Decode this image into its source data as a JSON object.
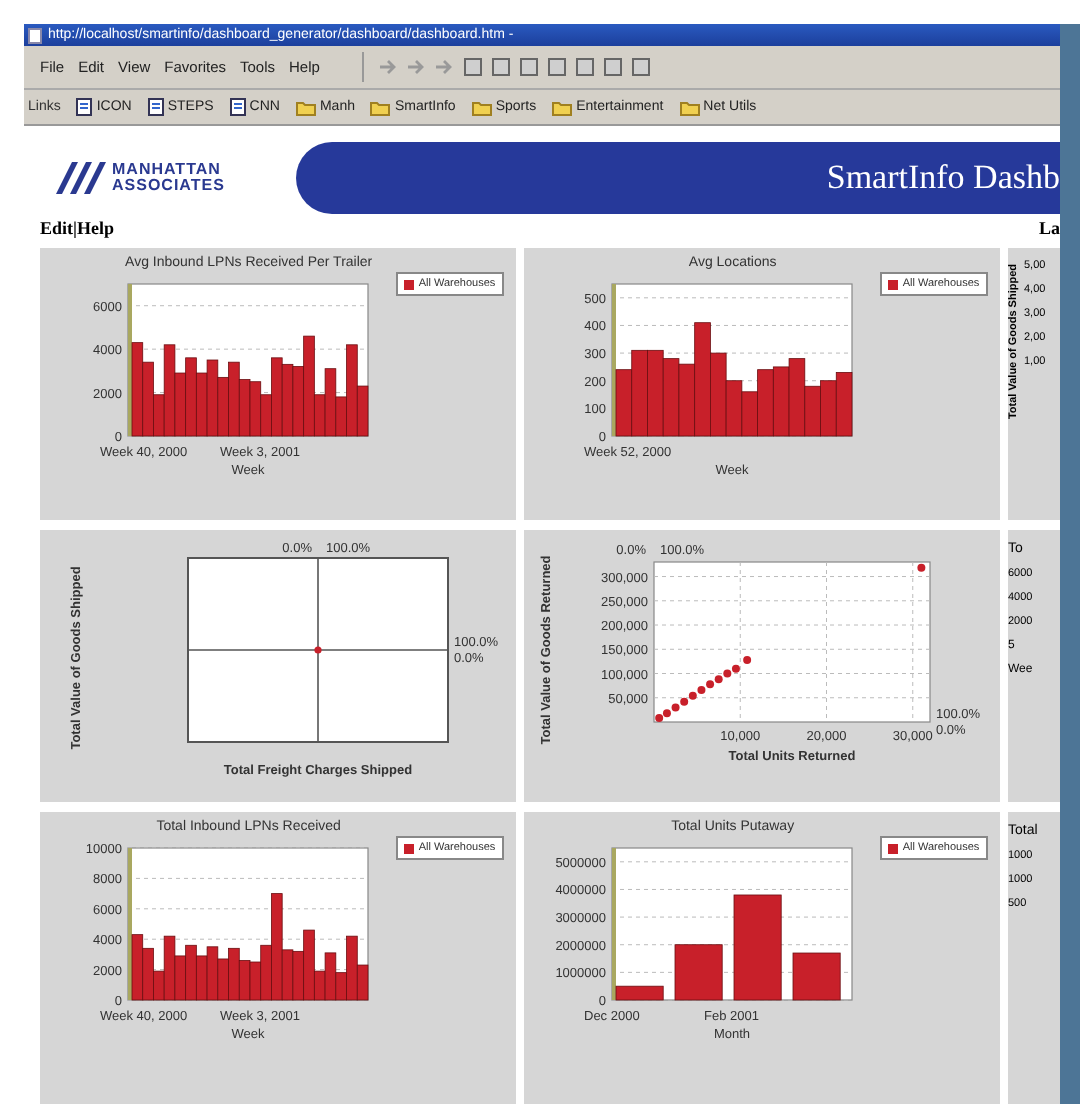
{
  "browser": {
    "title": "http://localhost/smartinfo/dashboard_generator/dashboard/dashboard.htm -",
    "menu": [
      "File",
      "Edit",
      "View",
      "Favorites",
      "Tools",
      "Help"
    ],
    "links_label": "Links",
    "links": [
      {
        "kind": "page",
        "label": "ICON"
      },
      {
        "kind": "page",
        "label": "STEPS"
      },
      {
        "kind": "page",
        "label": "CNN"
      },
      {
        "kind": "folder",
        "label": "Manh"
      },
      {
        "kind": "folder",
        "label": "SmartInfo"
      },
      {
        "kind": "folder",
        "label": "Sports"
      },
      {
        "kind": "folder",
        "label": "Entertainment"
      },
      {
        "kind": "folder",
        "label": "Net Utils"
      }
    ]
  },
  "page": {
    "logo_lines": [
      "MANHATTAN",
      "ASSOCIATES"
    ],
    "banner_title": "SmartInfo Dashb",
    "nav": "Edit|Help",
    "right_text": "La"
  },
  "rows": [
    {
      "panels": [
        {
          "kind": "chart",
          "tick_labels": [
            "Week 40, 2000",
            "Week 3, 2001"
          ],
          "chart_data": {
            "type": "bar",
            "title": "Avg Inbound LPNs Received Per Trailer",
            "xlabel": "Week",
            "ylim": [
              0,
              7000
            ],
            "yticks": [
              0,
              2000,
              4000,
              6000
            ],
            "grid": true,
            "series": [
              {
                "name": "All Warehouses",
                "color": "#c8202a",
                "values": [
                  4300,
                  3400,
                  1900,
                  4200,
                  2900,
                  3600,
                  2900,
                  3500,
                  2700,
                  3400,
                  2600,
                  2500,
                  1900,
                  3600,
                  3300,
                  3200,
                  4600,
                  1900,
                  3100,
                  1800,
                  4200,
                  2300
                ]
              }
            ]
          }
        },
        {
          "kind": "chart",
          "tick_labels": [
            "Week 52, 2000"
          ],
          "chart_data": {
            "type": "bar",
            "title": "Avg Locations",
            "xlabel": "Week",
            "ylim": [
              0,
              550
            ],
            "yticks": [
              0,
              100,
              200,
              300,
              400,
              500
            ],
            "grid": true,
            "series": [
              {
                "name": "All Warehouses",
                "color": "#c8202a",
                "values": [
                  240,
                  310,
                  310,
                  280,
                  260,
                  410,
                  300,
                  200,
                  160,
                  240,
                  250,
                  280,
                  180,
                  200,
                  230
                ]
              }
            ]
          }
        },
        {
          "kind": "partial",
          "ylabel": "Total Value of Goods Shipped",
          "ticks": [
            "5,00",
            "4,00",
            "3,00",
            "2,00",
            "1,00"
          ]
        }
      ]
    },
    {
      "panels": [
        {
          "kind": "quadrant",
          "ylabel": "Total Value of Goods Shipped",
          "xlabel": "Total Freight Charges Shipped",
          "top_labels": [
            "0.0%",
            "100.0%"
          ],
          "right_labels": [
            "100.0%",
            "0.0%"
          ]
        },
        {
          "kind": "chart",
          "top_labels": [
            "0.0%",
            "100.0%"
          ],
          "right_labels": [
            "100.0%",
            "0.0%"
          ],
          "chart_data": {
            "type": "scatter",
            "grid": true,
            "xlabel": "Total Units Returned",
            "ylabel": "Total Value of Goods Returned",
            "xlim": [
              0,
              32000
            ],
            "ylim": [
              0,
              330000
            ],
            "xticks": [
              {
                "value": 10000,
                "label": "10,000"
              },
              {
                "value": 20000,
                "label": "20,000"
              },
              {
                "value": 30000,
                "label": "30,000"
              }
            ],
            "yticks": [
              {
                "value": 50000,
                "label": "50,000"
              },
              {
                "value": 100000,
                "label": "100,000"
              },
              {
                "value": 150000,
                "label": "150,000"
              },
              {
                "value": 200000,
                "label": "200,000"
              },
              {
                "value": 250000,
                "label": "250,000"
              },
              {
                "value": 300000,
                "label": "300,000"
              }
            ],
            "x": [
              600,
              1500,
              2500,
              3500,
              4500,
              5500,
              6500,
              7500,
              8500,
              9500,
              10800,
              31000
            ],
            "series": [
              {
                "color": "#c8202a",
                "values": [
                  8000,
                  18000,
                  30000,
                  42000,
                  54000,
                  66000,
                  78000,
                  88000,
                  100000,
                  110000,
                  128000,
                  318000
                ]
              }
            ]
          }
        },
        {
          "kind": "partial",
          "title": "To",
          "ticks": [
            "6000",
            "4000",
            "2000"
          ],
          "footer": [
            "5",
            "Wee"
          ]
        }
      ]
    },
    {
      "panels": [
        {
          "kind": "chart",
          "tick_labels": [
            "Week 40, 2000",
            "Week 3, 2001"
          ],
          "chart_data": {
            "type": "bar",
            "title": "Total Inbound LPNs Received",
            "xlabel": "Week",
            "ylim": [
              0,
              10000
            ],
            "yticks": [
              0,
              2000,
              4000,
              6000,
              8000,
              10000
            ],
            "grid": true,
            "series": [
              {
                "name": "All Warehouses",
                "color": "#c8202a",
                "values": [
                  4300,
                  3400,
                  1900,
                  4200,
                  2900,
                  3600,
                  2900,
                  3500,
                  2700,
                  3400,
                  2600,
                  2500,
                  3600,
                  7000,
                  3300,
                  3200,
                  4600,
                  1900,
                  3100,
                  1800,
                  4200,
                  2300
                ]
              }
            ]
          }
        },
        {
          "kind": "chart",
          "tick_labels": [
            "Dec 2000",
            "Feb 2001"
          ],
          "chart_data": {
            "type": "bar",
            "title": "Total Units Putaway",
            "xlabel": "Month",
            "ylim": [
              0,
              5500000
            ],
            "yticks": [
              0,
              1000000,
              2000000,
              3000000,
              4000000,
              5000000
            ],
            "grid": true,
            "series": [
              {
                "name": "All Warehouses",
                "color": "#c8202a",
                "values": [
                  500000,
                  2000000,
                  3800000,
                  1700000
                ]
              }
            ]
          }
        },
        {
          "kind": "partial",
          "title": "Total",
          "ticks": [
            "1000",
            "1000",
            "500"
          ]
        }
      ]
    }
  ]
}
